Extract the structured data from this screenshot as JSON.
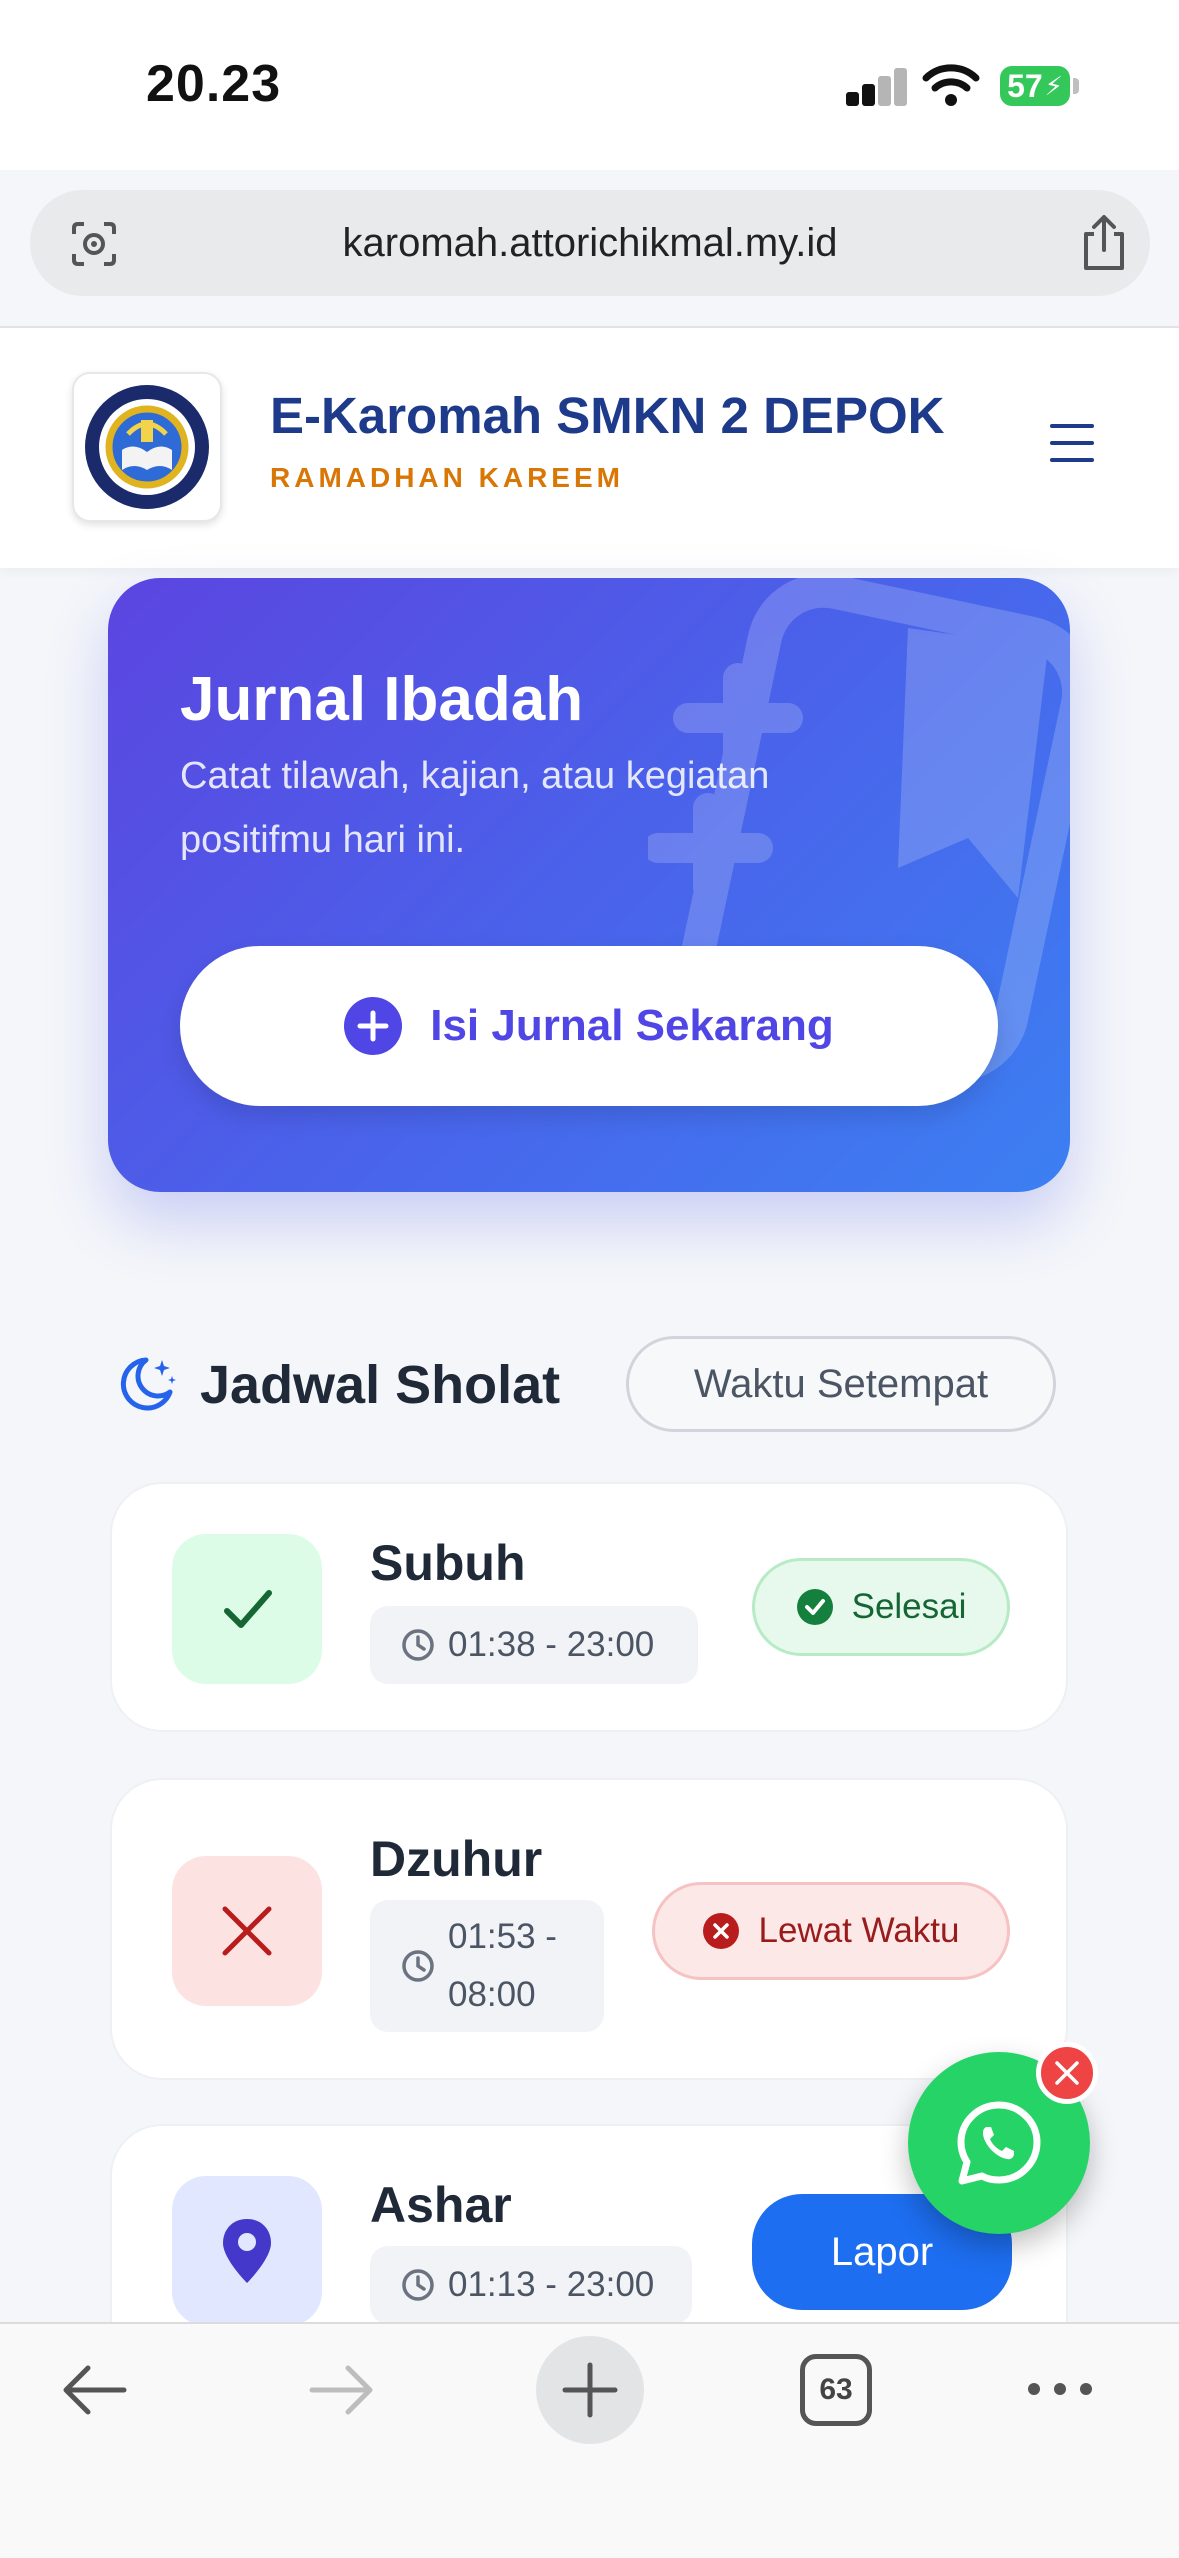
{
  "status_bar": {
    "time": "20.23",
    "battery": "57"
  },
  "browser": {
    "url": "karomah.attorichikmal.my.id",
    "tab_count": "63"
  },
  "app": {
    "title": "E-Karomah SMKN 2 DEPOK",
    "subtitle": "RAMADHAN KAREEM",
    "logo_text_top": "SMK NEGERI 2",
    "logo_text_bottom": "KOTA DEPOK"
  },
  "hero": {
    "title": "Jurnal Ibadah",
    "description": "Catat tilawah, kajian, atau kegiatan positifmu hari ini.",
    "button_label": "Isi Jurnal Sekarang"
  },
  "schedule": {
    "title": "Jadwal Sholat",
    "time_mode": "Waktu Setempat",
    "prayers": [
      {
        "name": "Subuh",
        "time": "01:38 - 23:00",
        "status": "Selesai",
        "state": "done"
      },
      {
        "name": "Dzuhur",
        "time_line1": "01:53 -",
        "time_line2": "08:00",
        "status": "Lewat Waktu",
        "state": "missed"
      },
      {
        "name": "Ashar",
        "time": "01:13 - 23:00",
        "status": "Lapor",
        "state": "report"
      }
    ]
  },
  "colors": {
    "primary": "#1e3a8a",
    "accent": "#d97706",
    "hero_start": "#5b45e0",
    "hero_end": "#3c7ff2",
    "success": "#16a34a",
    "danger": "#dc2626",
    "action_blue": "#1d6ef0",
    "whatsapp": "#25d366"
  }
}
